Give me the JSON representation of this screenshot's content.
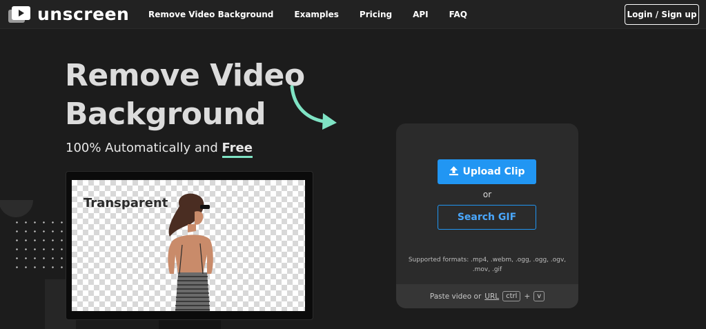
{
  "app": {
    "name": "unscreen"
  },
  "nav": {
    "links": [
      "Remove Video Background",
      "Examples",
      "Pricing",
      "API",
      "FAQ"
    ],
    "login_label": "Login / Sign up"
  },
  "hero": {
    "title": "Remove Video Background",
    "subtitle_prefix": "100% Automatically and ",
    "subtitle_emphasis": "Free"
  },
  "preview": {
    "label": "Transparent"
  },
  "upload": {
    "upload_label": "Upload Clip",
    "or_label": "or",
    "search_gif_label": "Search GIF",
    "formats_text": "Supported formats: .mp4, .webm, .ogg, .ogg, .ogv, .mov, .gif",
    "paste_prefix": "Paste video or",
    "paste_url": "URL",
    "key_ctrl": "ctrl",
    "key_plus": "+",
    "key_v": "v"
  },
  "colors": {
    "accent_blue": "#2196f3",
    "accent_green": "#7fe3c4",
    "background": "#1c1c1c"
  },
  "icons": {
    "logo": "play-screen-icon",
    "upload": "upload-icon",
    "arrow": "curved-arrow-icon"
  }
}
